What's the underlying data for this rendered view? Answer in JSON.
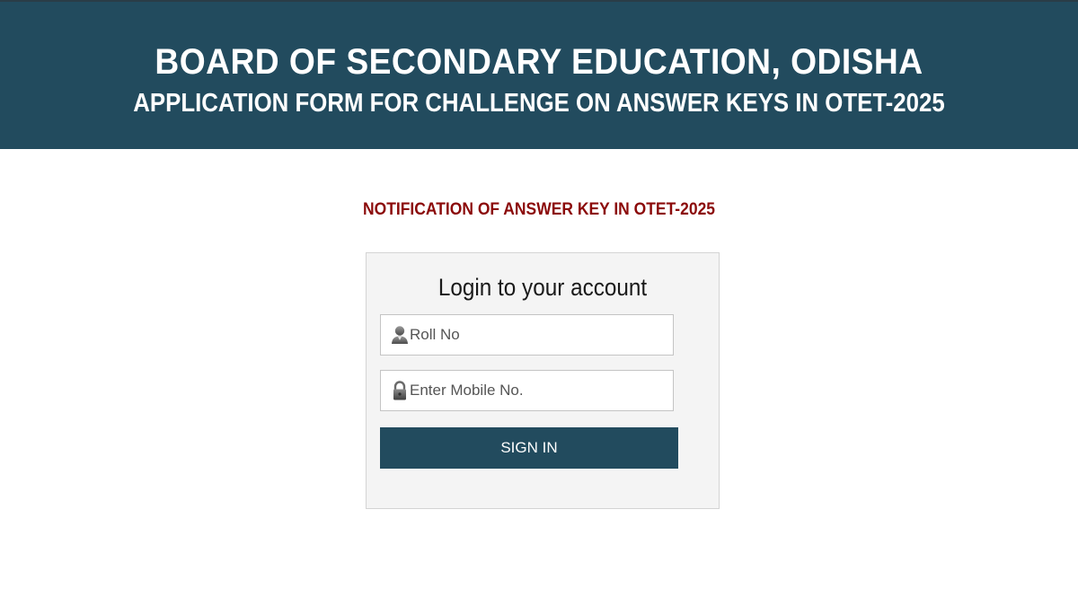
{
  "header": {
    "title": "BOARD OF SECONDARY EDUCATION, ODISHA",
    "subtitle": "APPLICATION FORM FOR CHALLENGE ON ANSWER KEYS IN OTET-2025",
    "background_color": "#224b5e"
  },
  "notice": {
    "text": "NOTIFICATION OF ANSWER KEY IN OTET-2025",
    "color": "#8b0a0a"
  },
  "login": {
    "title": "Login to your account",
    "roll_no": {
      "placeholder": "Roll No",
      "value": "",
      "icon": "user-icon"
    },
    "mobile": {
      "placeholder": "Enter Mobile No.",
      "value": "",
      "icon": "lock-icon"
    },
    "signin_label": "SIGN IN"
  }
}
